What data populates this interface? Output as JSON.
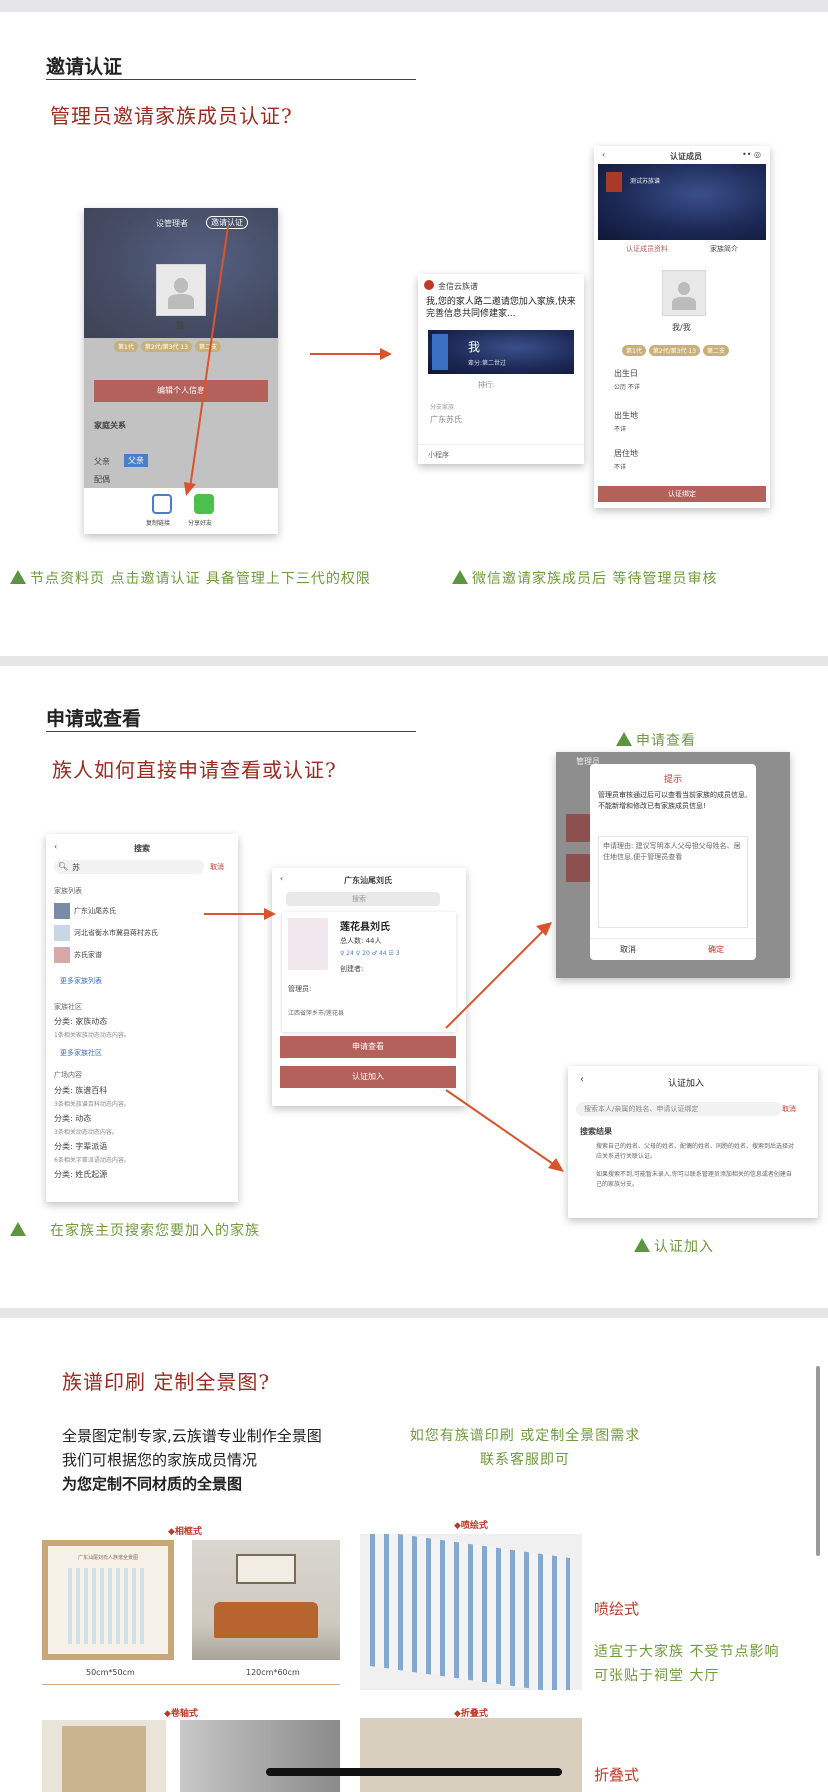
{
  "section1": {
    "title": "邀请认证",
    "heading": "管理员邀请家族成员认证?",
    "caption_left": "节点资料页 点击邀请认证 具备管理上下三代的权限",
    "caption_right": "微信邀请家族成员后 等待管理员审核",
    "shot1": {
      "top_left": "设管理者",
      "invite_btn": "邀请认证",
      "name": "我",
      "tags": [
        "第1代",
        "第2代/第3代 13",
        "第二支"
      ],
      "edit_btn": "编辑个人信息",
      "family_label": "家庭关系",
      "father_label": "父亲",
      "father_value": "父亲",
      "spouse_label": "配偶",
      "share_copy": "复制链接",
      "share_wechat": "分享好友"
    },
    "shot2": {
      "sender": "金信云族谱",
      "message": "我,您的家人路二邀请您加入家族,快来完善信息共同修建家...",
      "card_name": "我",
      "card_sub": "辈分:第二世过",
      "card_sub2": "排行:",
      "family_label": "分支家族",
      "family_value": "广东苏氏",
      "mini": "小程序"
    },
    "shot3": {
      "title": "认证成员",
      "banner_text": "测试苏族谱",
      "tab1": "认证成员资料",
      "tab2": "家族简介",
      "name": "我/我",
      "f1_label": "出生日",
      "f1_value": "公历  不详",
      "f2_label": "出生地",
      "f2_value": "不详",
      "f3_label": "居住地",
      "f3_value": "不详",
      "btn": "认证绑定"
    }
  },
  "section2": {
    "title": "申请或查看",
    "heading": "族人如何直接申请查看或认证?",
    "label_apply": "申请查看",
    "label_certify": "认证加入",
    "caption": "在家族主页搜索您要加入的家族",
    "search": {
      "title": "搜索",
      "query": "苏",
      "cancel": "取消",
      "group1": "家族列表",
      "items": [
        "广东汕尾苏氏",
        "河北省衡水市冀县蒋村苏氏",
        "苏氏家谱"
      ],
      "more1": "更多家族列表",
      "group2": "家族社区",
      "community": [
        "分类: 家族动态",
        "1条相关家族动态动态内容。"
      ],
      "more2": "更多家族社区",
      "group3": "广场内容",
      "plaza": [
        "分类: 族谱百科",
        "3条相关族谱百科动态内容。",
        "分类: 动态",
        "3条相关动态动态内容。",
        "分类: 字辈派语",
        "6条相关字辈派语动态内容。",
        "分类: 姓氏起源"
      ]
    },
    "family": {
      "title": "广东汕尾刘氏",
      "search_ph": "搜索",
      "name": "莲花县刘氏",
      "total": "总人数: 44人",
      "stats": "♀ 24  ♀ 20  ♂ 44  ☰ 3",
      "creator": "创建者:",
      "manager": "管理员:",
      "location": "江西省萍乡市/莲花县",
      "btn_apply": "申请查看",
      "btn_certify": "认证加入"
    },
    "dialog": {
      "bg_text": "管理员",
      "title": "提示",
      "desc": "管理员审核通过后可以查看当前家族的成员信息,不能新增和修改已有家族成员信息!",
      "reason": "申请理由: 建议写明本人父母祖父母姓名、居住地信息,便于管理员查看",
      "cancel": "取消",
      "ok": "确定"
    },
    "certify": {
      "title": "认证加入",
      "search_ph": "搜索本人/亲属的姓名、申请认证绑定",
      "cancel": "取消",
      "result": "搜索结果",
      "tip1": "搜索自己的姓名、父母的姓名、配偶的姓名、同胞的姓名、搜索到后选择对应关系进行关联认证。",
      "tip2": "如果搜索不到,可能暂未录入,你可以联系管理员添加相关的信息或者创建自己的家族分支。"
    }
  },
  "section3": {
    "heading": "族谱印刷 定制全景图?",
    "body": [
      "全景图定制专家,云族谱专业制作全景图",
      "我们可根据您的家族成员情况",
      "为您定制不同材质的全景图"
    ],
    "green": [
      "如您有族谱印刷  或定制全景图需求",
      "联系客服即可"
    ],
    "label_frame": "◆相框式",
    "label_poster": "◆喷绘式",
    "label_scroll": "◆卷轴式",
    "label_fold": "◆折叠式",
    "frame_title": "广东汕尾刘氏人族谱全景图",
    "size1": "50cm*50cm",
    "size2": "120cm*60cm",
    "style1": "喷绘式",
    "style1_desc": [
      "适宜于大家族 不受节点影响",
      "可张贴于祠堂 大厅"
    ],
    "style2": "折叠式"
  }
}
